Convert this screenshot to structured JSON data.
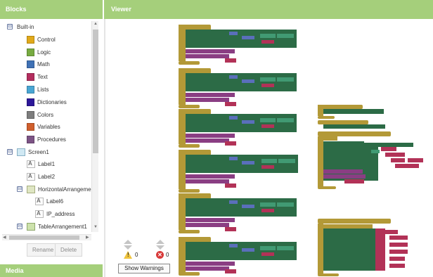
{
  "blocks_panel": {
    "title": "Blocks",
    "builtin": {
      "label": "Built-in",
      "toggle": "⊟",
      "items": [
        {
          "label": "Control",
          "color": "#e1a91a"
        },
        {
          "label": "Logic",
          "color": "#77ab41"
        },
        {
          "label": "Math",
          "color": "#3f71b5"
        },
        {
          "label": "Text",
          "color": "#b32d5e"
        },
        {
          "label": "Lists",
          "color": "#49a6d4"
        },
        {
          "label": "Dictionaries",
          "color": "#2d1799"
        },
        {
          "label": "Colors",
          "color": "#7d7d7d"
        },
        {
          "label": "Variables",
          "color": "#d05f2d"
        },
        {
          "label": "Procedures",
          "color": "#7c5385"
        }
      ]
    },
    "components": [
      {
        "label": "Screen1",
        "toggle": "⊟",
        "icon": "screen-icon"
      },
      {
        "label": "Label1",
        "icon": "label-icon"
      },
      {
        "label": "Label2",
        "icon": "label-icon"
      },
      {
        "label": "HorizontalArrangemen",
        "toggle": "⊟",
        "icon": "horizontal-arrangement-icon"
      },
      {
        "label": "Label6",
        "icon": "label-icon"
      },
      {
        "label": "IP_address",
        "icon": "label-icon"
      },
      {
        "label": "TableArrangement1",
        "toggle": "⊟",
        "icon": "table-arrangement-icon"
      }
    ],
    "rename_label": "Rename",
    "delete_label": "Delete"
  },
  "media": {
    "title": "Media"
  },
  "viewer": {
    "title": "Viewer",
    "warnings": {
      "warning_count": "0",
      "error_count": "0",
      "error_glyph": "✕",
      "show_warnings_label": "Show Warnings"
    }
  },
  "colors": {
    "header_green": "#a5cf7b",
    "event_block": "#b39937",
    "component_setter": "#2c6b46",
    "procedure_call": "#8a3e83",
    "text_block": "#b23257",
    "math_block": "#5a6fbb"
  }
}
